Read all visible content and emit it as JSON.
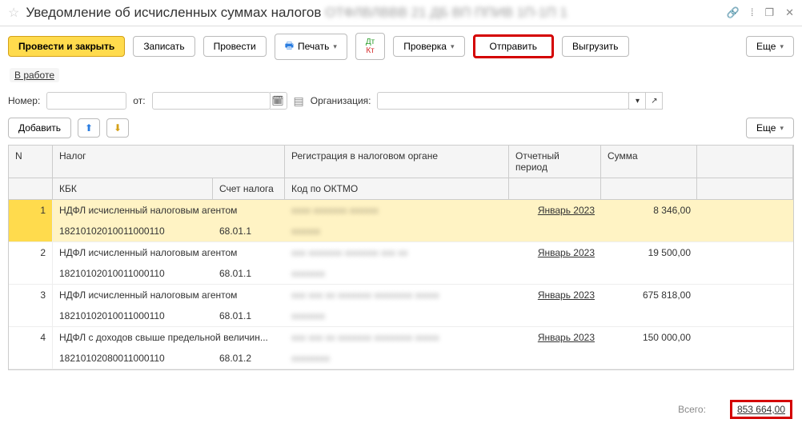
{
  "title": "Уведомление об исчисленных суммах налогов",
  "toolbar": {
    "submit_close": "Провести и закрыть",
    "record": "Записать",
    "submit": "Провести",
    "print": "Печать",
    "check": "Проверка",
    "send": "Отправить",
    "export": "Выгрузить",
    "more": "Еще"
  },
  "status": {
    "label": "В работе"
  },
  "form": {
    "number_lbl": "Номер:",
    "from_lbl": "от:",
    "org_lbl": "Организация:"
  },
  "row2": {
    "add": "Добавить",
    "more": "Еще"
  },
  "grid": {
    "headers": {
      "n": "N",
      "tax": "Налог",
      "kbk": "КБК",
      "account": "Счет налога",
      "registration": "Регистрация в налоговом органе",
      "oktmo": "Код по ОКТМО",
      "period": "Отчетный период",
      "sum": "Сумма"
    },
    "rows": [
      {
        "n": "1",
        "tax": "НДФЛ исчисленный налоговым агентом",
        "kbk": "18210102010011000110",
        "acct": "68.01.1",
        "period": "Январь 2023",
        "sum": "8 346,00"
      },
      {
        "n": "2",
        "tax": "НДФЛ исчисленный налоговым агентом",
        "kbk": "18210102010011000110",
        "acct": "68.01.1",
        "period": "Январь 2023",
        "sum": "19 500,00"
      },
      {
        "n": "3",
        "tax": "НДФЛ исчисленный налоговым агентом",
        "kbk": "18210102010011000110",
        "acct": "68.01.1",
        "period": "Январь 2023",
        "sum": "675 818,00"
      },
      {
        "n": "4",
        "tax": "НДФЛ с доходов свыше предельной величин...",
        "kbk": "18210102080011000110",
        "acct": "68.01.2",
        "period": "Январь 2023",
        "sum": "150 000,00"
      }
    ]
  },
  "footer": {
    "total_lbl": "Всего:",
    "total_val": "853 664,00"
  }
}
